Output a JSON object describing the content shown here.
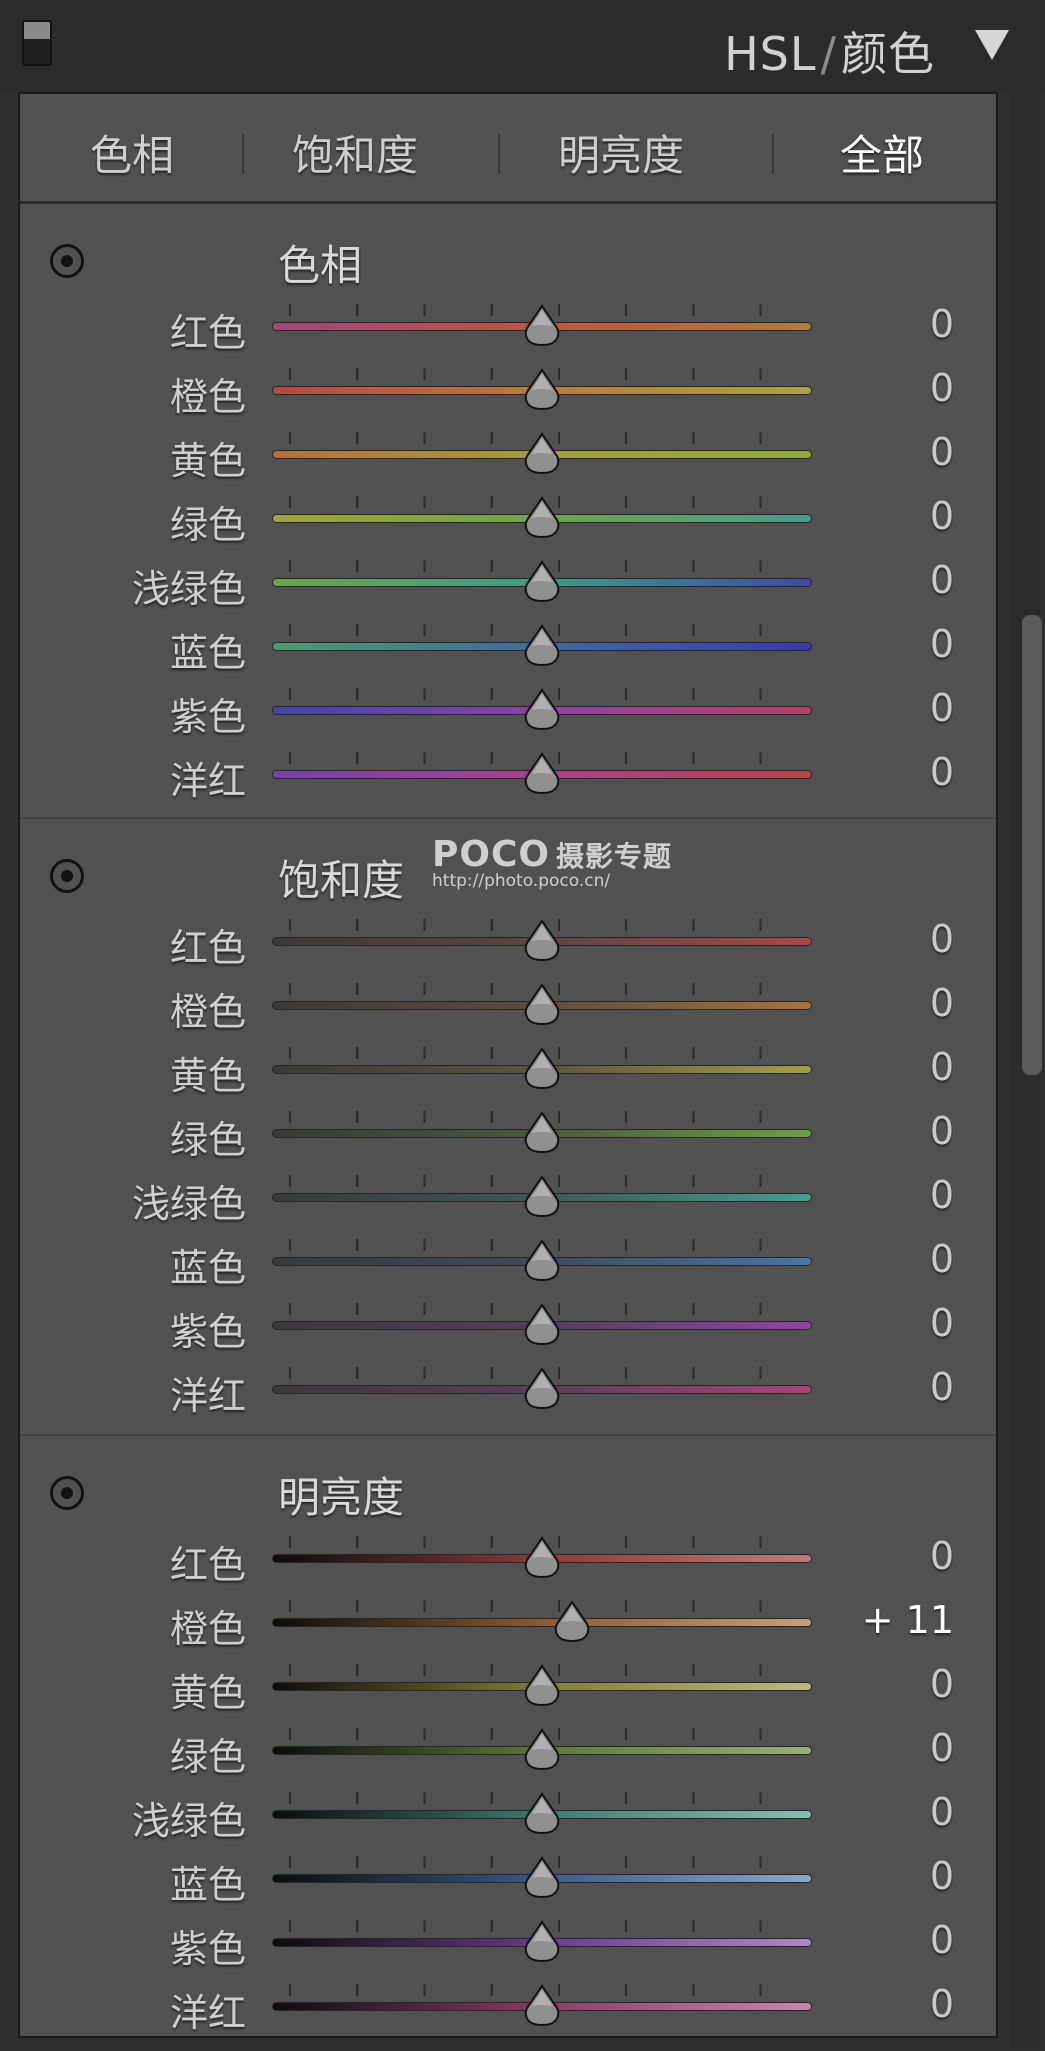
{
  "header": {
    "title_left": "HSL",
    "separator": "/",
    "title_right": "颜色"
  },
  "tabs": [
    {
      "label": "色相",
      "active": false
    },
    {
      "label": "饱和度",
      "active": false
    },
    {
      "label": "明亮度",
      "active": false
    },
    {
      "label": "全部",
      "active": true
    }
  ],
  "watermark": {
    "brand": "POCO",
    "brand_cn": "摄影专题",
    "url": "http://photo.poco.cn/"
  },
  "sections": [
    {
      "title": "色相",
      "rows": [
        {
          "label": "红色",
          "value": "0",
          "fraction": 0.5,
          "gradient": [
            "#a0487c",
            "#b8573f",
            "#b17a3c"
          ]
        },
        {
          "label": "橙色",
          "value": "0",
          "fraction": 0.5,
          "gradient": [
            "#b24a46",
            "#b87b3e",
            "#a9a24a"
          ]
        },
        {
          "label": "黄色",
          "value": "0",
          "fraction": 0.5,
          "gradient": [
            "#b3703d",
            "#a59b42",
            "#8daa42"
          ]
        },
        {
          "label": "绿色",
          "value": "0",
          "fraction": 0.5,
          "gradient": [
            "#a0a33f",
            "#6fa44a",
            "#4a9a8c"
          ]
        },
        {
          "label": "浅绿色",
          "value": "0",
          "fraction": 0.5,
          "gradient": [
            "#6ea24a",
            "#3f9b8a",
            "#3f4aa0"
          ]
        },
        {
          "label": "蓝色",
          "value": "0",
          "fraction": 0.5,
          "gradient": [
            "#4f9a6c",
            "#3f6aa0",
            "#3a3aa8"
          ]
        },
        {
          "label": "紫色",
          "value": "0",
          "fraction": 0.5,
          "gradient": [
            "#3e46a8",
            "#8e42a2",
            "#b24266"
          ]
        },
        {
          "label": "洋红",
          "value": "0",
          "fraction": 0.5,
          "gradient": [
            "#7442a8",
            "#a8428e",
            "#b5464a"
          ]
        }
      ]
    },
    {
      "title": "饱和度",
      "rows": [
        {
          "label": "红色",
          "value": "0",
          "fraction": 0.5,
          "gradient": [
            "#3a3a3a",
            "#5c4444",
            "#a84848"
          ]
        },
        {
          "label": "橙色",
          "value": "0",
          "fraction": 0.5,
          "gradient": [
            "#3a3a3a",
            "#5c4c3e",
            "#a8743e"
          ]
        },
        {
          "label": "黄色",
          "value": "0",
          "fraction": 0.5,
          "gradient": [
            "#3a3a3a",
            "#58553e",
            "#a69e48"
          ]
        },
        {
          "label": "绿色",
          "value": "0",
          "fraction": 0.5,
          "gradient": [
            "#3a3a3a",
            "#4a583e",
            "#6ea044"
          ]
        },
        {
          "label": "浅绿色",
          "value": "0",
          "fraction": 0.5,
          "gradient": [
            "#3a3a3a",
            "#3e5852",
            "#44a08c"
          ]
        },
        {
          "label": "蓝色",
          "value": "0",
          "fraction": 0.5,
          "gradient": [
            "#3a3a3a",
            "#3e4a5a",
            "#4a76a8"
          ]
        },
        {
          "label": "紫色",
          "value": "0",
          "fraction": 0.5,
          "gradient": [
            "#3a3a3a",
            "#523e5a",
            "#9244a8"
          ]
        },
        {
          "label": "洋红",
          "value": "0",
          "fraction": 0.5,
          "gradient": [
            "#3a3a3a",
            "#5a3e52",
            "#a8447a"
          ]
        }
      ]
    },
    {
      "title": "明亮度",
      "rows": [
        {
          "label": "红色",
          "value": "0",
          "fraction": 0.5,
          "gradient": [
            "#0c0c0c",
            "#8a3a3a",
            "#c07a7a"
          ]
        },
        {
          "label": "橙色",
          "value": "+ 11",
          "fraction": 0.555,
          "gradient": [
            "#0c0c0c",
            "#8a5a32",
            "#c4a07c"
          ]
        },
        {
          "label": "黄色",
          "value": "0",
          "fraction": 0.5,
          "gradient": [
            "#0c0c0c",
            "#857a36",
            "#c0b884"
          ]
        },
        {
          "label": "绿色",
          "value": "0",
          "fraction": 0.5,
          "gradient": [
            "#0c0c0c",
            "#5a7a38",
            "#98b07c"
          ]
        },
        {
          "label": "浅绿色",
          "value": "0",
          "fraction": 0.5,
          "gradient": [
            "#0c0c0c",
            "#3e7a6e",
            "#88c0b0"
          ]
        },
        {
          "label": "蓝色",
          "value": "0",
          "fraction": 0.5,
          "gradient": [
            "#0c0c0c",
            "#3a5a88",
            "#88a8cc"
          ]
        },
        {
          "label": "紫色",
          "value": "0",
          "fraction": 0.5,
          "gradient": [
            "#0c0c0c",
            "#6a3a88",
            "#b088c4"
          ]
        },
        {
          "label": "洋红",
          "value": "0",
          "fraction": 0.5,
          "gradient": [
            "#0c0c0c",
            "#8a3a6a",
            "#c488b0"
          ]
        }
      ]
    }
  ]
}
